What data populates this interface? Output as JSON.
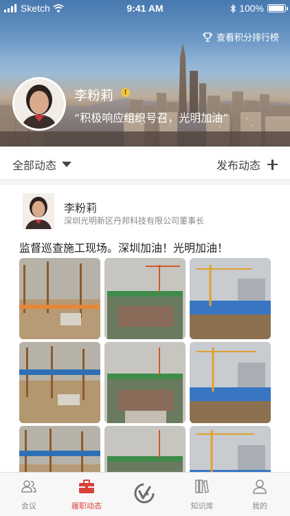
{
  "statusbar": {
    "carrier": "Sketch",
    "time": "9:41 AM",
    "battery": "100%",
    "battery_level": 1.0,
    "icons": [
      "signal-bars-icon",
      "wifi-icon",
      "bluetooth-icon",
      "battery-icon"
    ]
  },
  "header": {
    "rank_link_label": "查看积分排行榜",
    "rank_icon": "trophy-icon",
    "profile_name": "李粉莉",
    "profile_badge": "!",
    "profile_quote": "“积极响应组织号召，光明加油”"
  },
  "filter": {
    "all_label": "全部动态",
    "post_label": "发布动态"
  },
  "post": {
    "author": "李粉莉",
    "organization": "深圳光明新区丹邦科技有限公司董事长",
    "text": "监督巡查施工现场。深圳加油！光明加油！",
    "images": [
      "construction-photo-1",
      "construction-photo-2",
      "construction-photo-3",
      "construction-photo-4",
      "construction-photo-5",
      "construction-photo-6",
      "construction-photo-7",
      "construction-photo-8",
      "construction-photo-9"
    ]
  },
  "tabbar": {
    "items": [
      {
        "label": "会议",
        "icon": "meeting-users-icon",
        "active": false
      },
      {
        "label": "履职动态",
        "icon": "briefcase-icon",
        "active": true
      },
      {
        "label": "",
        "icon": "center-logo-icon",
        "active": false
      },
      {
        "label": "知识库",
        "icon": "books-icon",
        "active": false
      },
      {
        "label": "我的",
        "icon": "profile-icon",
        "active": false
      }
    ]
  },
  "colors": {
    "accent": "#d9403a",
    "tab_inactive": "#8a8a8a",
    "text_primary": "#333333",
    "text_secondary": "#888888"
  }
}
